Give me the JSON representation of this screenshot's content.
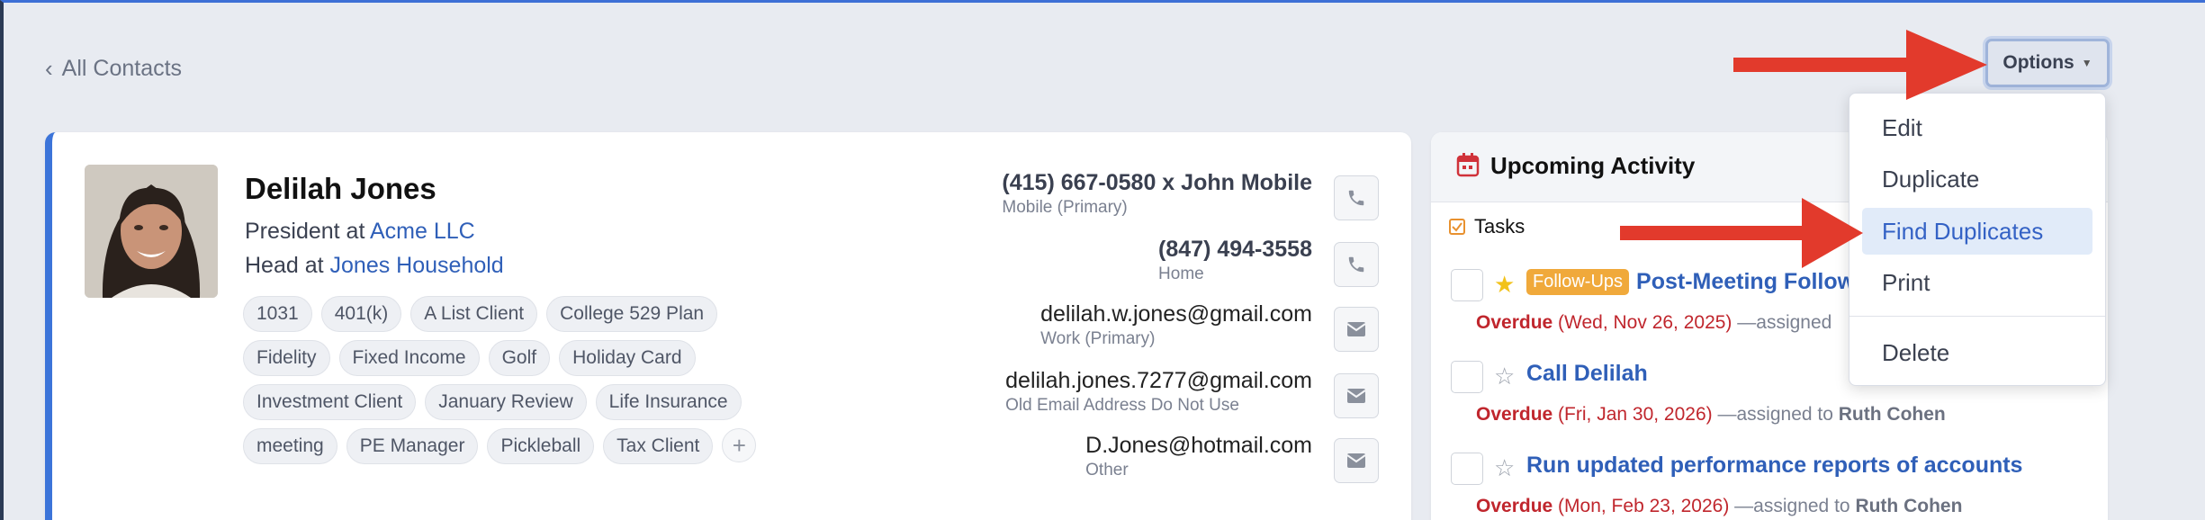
{
  "nav": {
    "back_label": "All Contacts"
  },
  "options": {
    "button_label": "Options",
    "menu": [
      "Edit",
      "Duplicate",
      "Find Duplicates",
      "Print",
      "Delete"
    ],
    "highlighted": "Find Duplicates"
  },
  "contact": {
    "name": "Delilah Jones",
    "role1_prefix": "President at",
    "role1_org": "Acme LLC",
    "role2_prefix": "Head at",
    "role2_org": "Jones Household",
    "tags": [
      [
        "1031",
        "401(k)",
        "A List Client",
        "College 529 Plan"
      ],
      [
        "Fidelity",
        "Fixed Income",
        "Golf",
        "Holiday Card"
      ],
      [
        "Investment Client",
        "January Review",
        "Life Insurance"
      ],
      [
        "meeting",
        "PE Manager",
        "Pickleball",
        "Tax Client"
      ]
    ],
    "methods": [
      {
        "value": "(415) 667-0580 x John Mobile",
        "label": "Mobile (Primary)",
        "icon": "phone-icon"
      },
      {
        "value": "(847) 494-3558",
        "label": "Home",
        "icon": "phone-icon"
      },
      {
        "value": "delilah.w.jones@gmail.com",
        "label": "Work (Primary)",
        "icon": "mail-icon"
      },
      {
        "value": "delilah.jones.7277@gmail.com",
        "label": "Old Email Address Do Not Use",
        "icon": "mail-icon"
      },
      {
        "value": "D.Jones@hotmail.com",
        "label": "Other",
        "icon": "mail-icon"
      }
    ]
  },
  "activity": {
    "title": "Upcoming Activity",
    "tasks_label": "Tasks",
    "tasks": [
      {
        "badge": "Follow-Ups",
        "title": "Post-Meeting Follow",
        "status": "Overdue",
        "date": "(Wed, Nov 26, 2025)",
        "assigned_text": "—assigned",
        "assignee": "",
        "starred": true
      },
      {
        "badge": "",
        "title": "Call Delilah",
        "status": "Overdue",
        "date": "(Fri, Jan 30, 2026)",
        "assigned_text": "—assigned to",
        "assignee": "Ruth Cohen",
        "starred": false
      },
      {
        "badge": "",
        "title": "Run updated performance reports of accounts",
        "status": "Overdue",
        "date": "(Mon, Feb 23, 2026)",
        "assigned_text": "—assigned to",
        "assignee": "Ruth Cohen",
        "starred": false
      }
    ]
  },
  "colors": {
    "accent": "#3c74d9",
    "link": "#2f5fb8",
    "overdue": "#c0262d",
    "badge": "#f0a93b",
    "arrow": "#e23a2c"
  }
}
